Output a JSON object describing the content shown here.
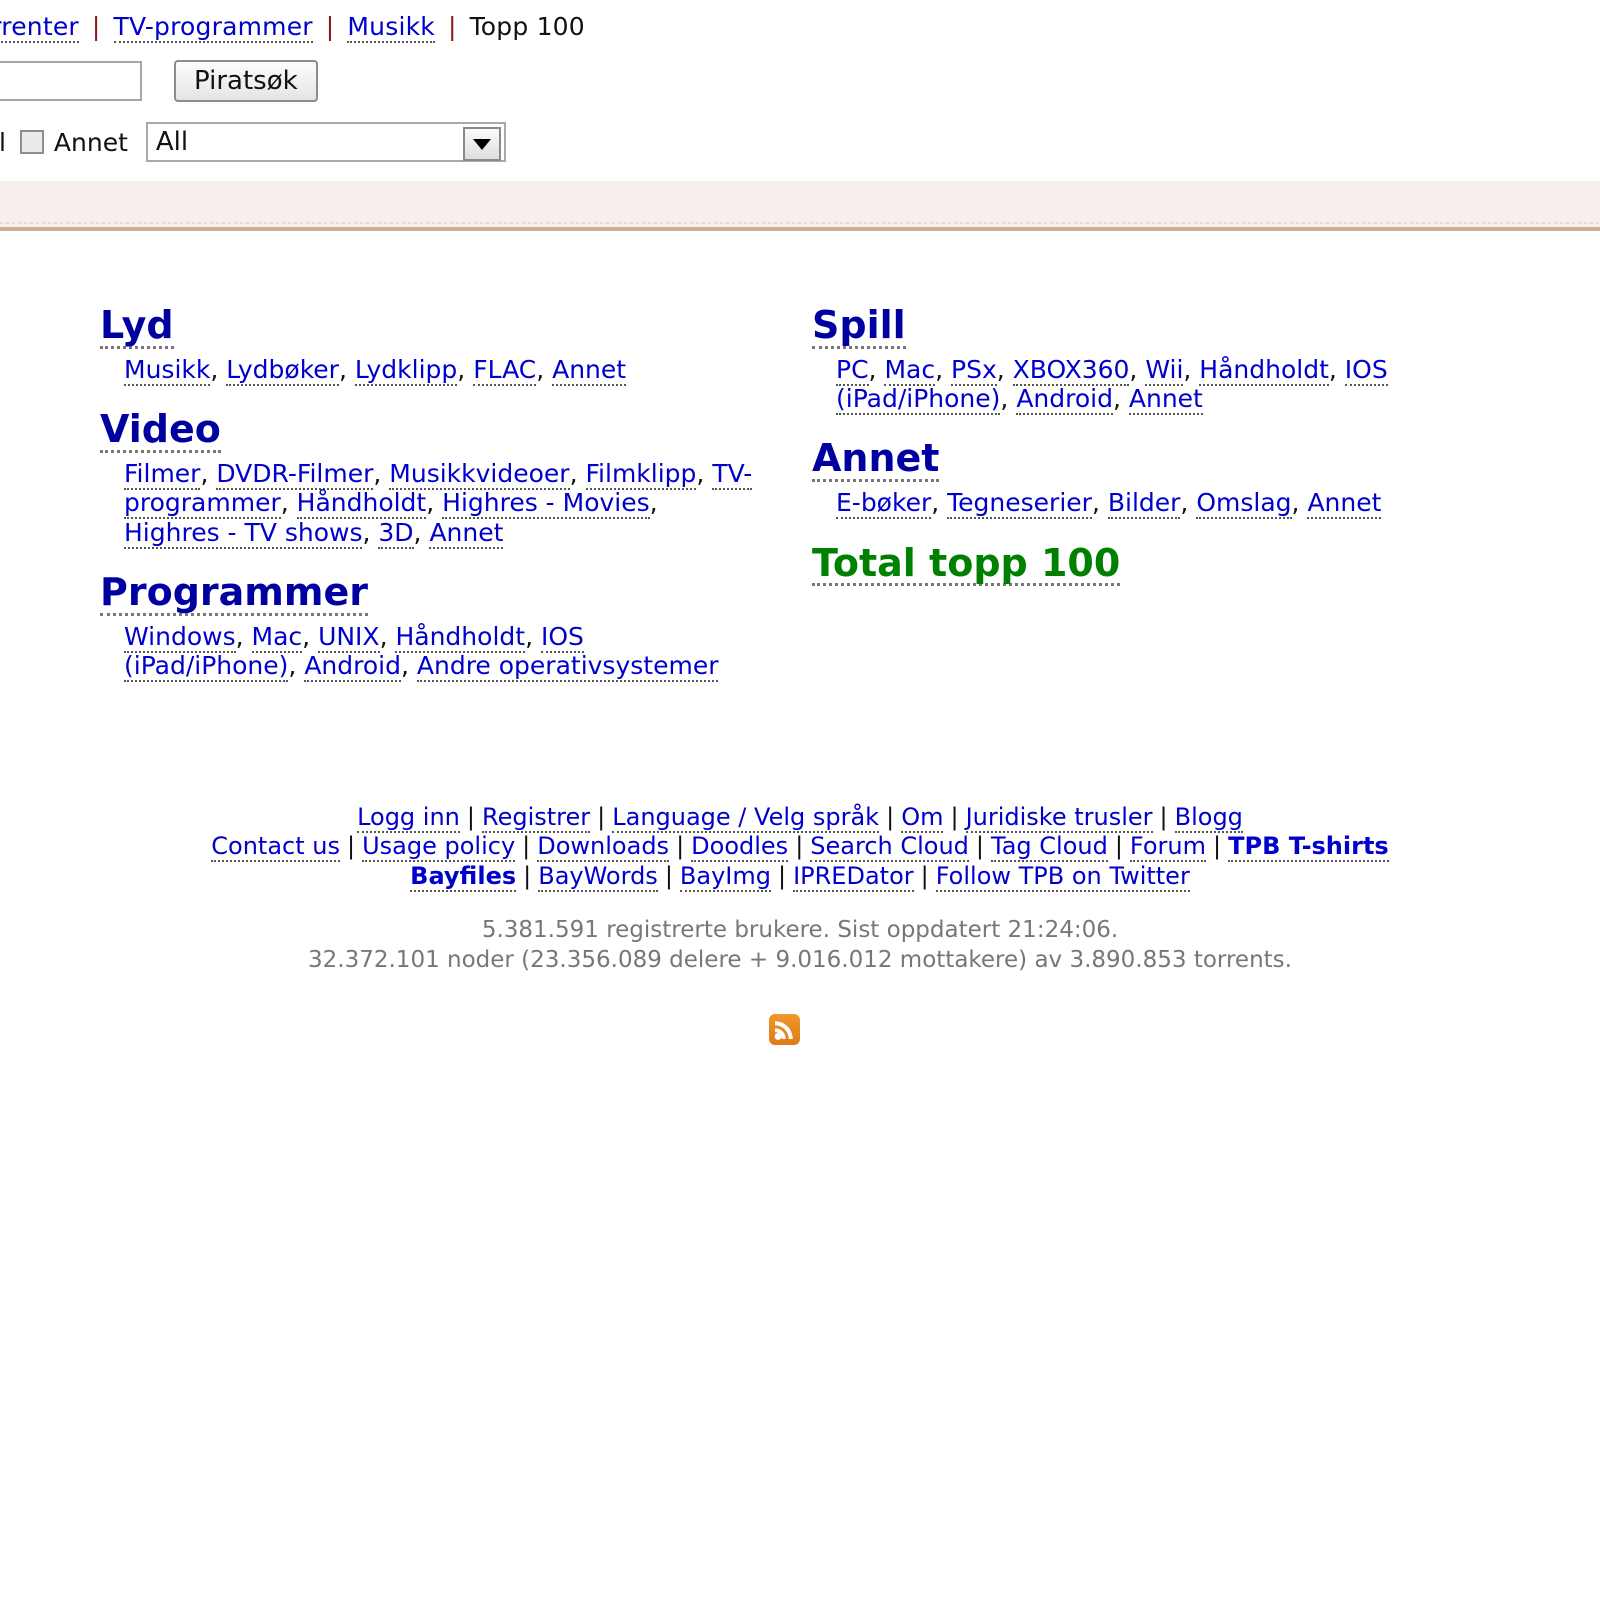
{
  "topnav": {
    "items": [
      {
        "label": "e torrenter",
        "link": true
      },
      {
        "label": "TV-programmer",
        "link": true
      },
      {
        "label": "Musikk",
        "link": true
      },
      {
        "label": "Topp 100",
        "link": false
      }
    ],
    "separator": "|"
  },
  "search": {
    "query_value": "",
    "placeholder": "",
    "submit_label": "Piratsøk"
  },
  "options": {
    "cut_label": "ll",
    "checkbox_label": "Annet",
    "checkbox_checked": false,
    "category_select_value": "All",
    "category_select_options": [
      "All"
    ]
  },
  "categories": {
    "left": [
      {
        "title": "Lyd",
        "links": [
          "Musikk",
          "Lydbøker",
          "Lydklipp",
          "FLAC",
          "Annet"
        ]
      },
      {
        "title": "Video",
        "links": [
          "Filmer",
          "DVDR-Filmer",
          "Musikkvideoer",
          "Filmklipp",
          "TV-programmer",
          "Håndholdt",
          "Highres - Movies",
          "Highres - TV shows",
          "3D",
          "Annet"
        ]
      },
      {
        "title": "Programmer",
        "links": [
          "Windows",
          "Mac",
          "UNIX",
          "Håndholdt",
          "IOS (iPad/iPhone)",
          "Android",
          "Andre operativsystemer"
        ]
      }
    ],
    "right": [
      {
        "title": "Spill",
        "links": [
          "PC",
          "Mac",
          "PSx",
          "XBOX360",
          "Wii",
          "Håndholdt",
          "IOS (iPad/iPhone)",
          "Android",
          "Annet"
        ]
      },
      {
        "title": "Annet",
        "links": [
          "E-bøker",
          "Tegneserier",
          "Bilder",
          "Omslag",
          "Annet"
        ]
      }
    ],
    "total_top_100": "Total topp 100"
  },
  "footer": {
    "row1": [
      "Logg inn",
      "Registrer",
      "Language / Velg språk",
      "Om",
      "Juridiske trusler",
      "Blogg"
    ],
    "row2": [
      "Contact us",
      "Usage policy",
      "Downloads",
      "Doodles",
      "Search Cloud",
      "Tag Cloud",
      "Forum",
      "TPB T-shirts"
    ],
    "row3": [
      "Bayfiles",
      "BayWords",
      "BayImg",
      "IPREDator",
      "Follow TPB on Twitter"
    ],
    "bold_links": [
      "TPB T-shirts",
      "Bayfiles"
    ],
    "separator": "|"
  },
  "stats": {
    "line1": "5.381.591 registrerte brukere. Sist oppdatert 21:24:06.",
    "line2": "32.372.101 noder (23.356.089 delere + 9.016.012 mottakere) av 3.890.853 torrents."
  },
  "rss": {
    "icon": "rss-icon"
  },
  "colors": {
    "link": "#0000cc",
    "heading": "#0000a0",
    "green": "#008000",
    "band": "#f6efec",
    "band_border": "#cfae99",
    "rss_orange": "#e07b18",
    "stats_gray": "#777777"
  }
}
